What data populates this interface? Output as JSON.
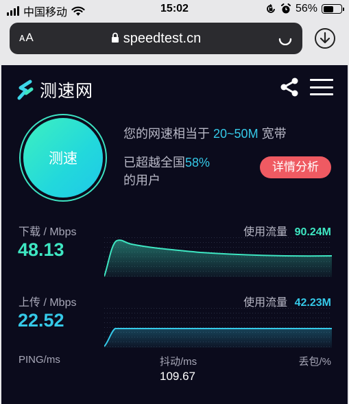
{
  "status_bar": {
    "carrier": "中国移动",
    "time": "15:02",
    "battery": "56%",
    "battery_level": 0.56
  },
  "browser": {
    "address_left": "ᴀA",
    "url": "speedtest.cn"
  },
  "header": {
    "brand": "测速网"
  },
  "main": {
    "test_button": "测速",
    "summary_prefix": "您的网速相当于",
    "summary_speed": "20~50M",
    "summary_suffix": "宽带",
    "beat_prefix": "已超越全国",
    "beat_percent": "58%",
    "beat_suffix": "的用户",
    "detail_button": "详情分析"
  },
  "download": {
    "label": "下载 / Mbps",
    "value": "48.13",
    "usage_label": "使用流量",
    "usage_value": "90.24M",
    "color": "#3ee6c2"
  },
  "upload": {
    "label": "上传 / Mbps",
    "value": "22.52",
    "usage_label": "使用流量",
    "usage_value": "42.23M",
    "color": "#35c9e8"
  },
  "stats": {
    "ping_label": "PING/ms",
    "jitter_label": "抖动/ms",
    "jitter_value": "109.67",
    "loss_label": "丢包/%"
  },
  "colors": {
    "background": "#0b0b1c",
    "accent_green": "#3ee6c2",
    "accent_blue": "#35c9e8",
    "detail_red": "#ef5a62"
  }
}
